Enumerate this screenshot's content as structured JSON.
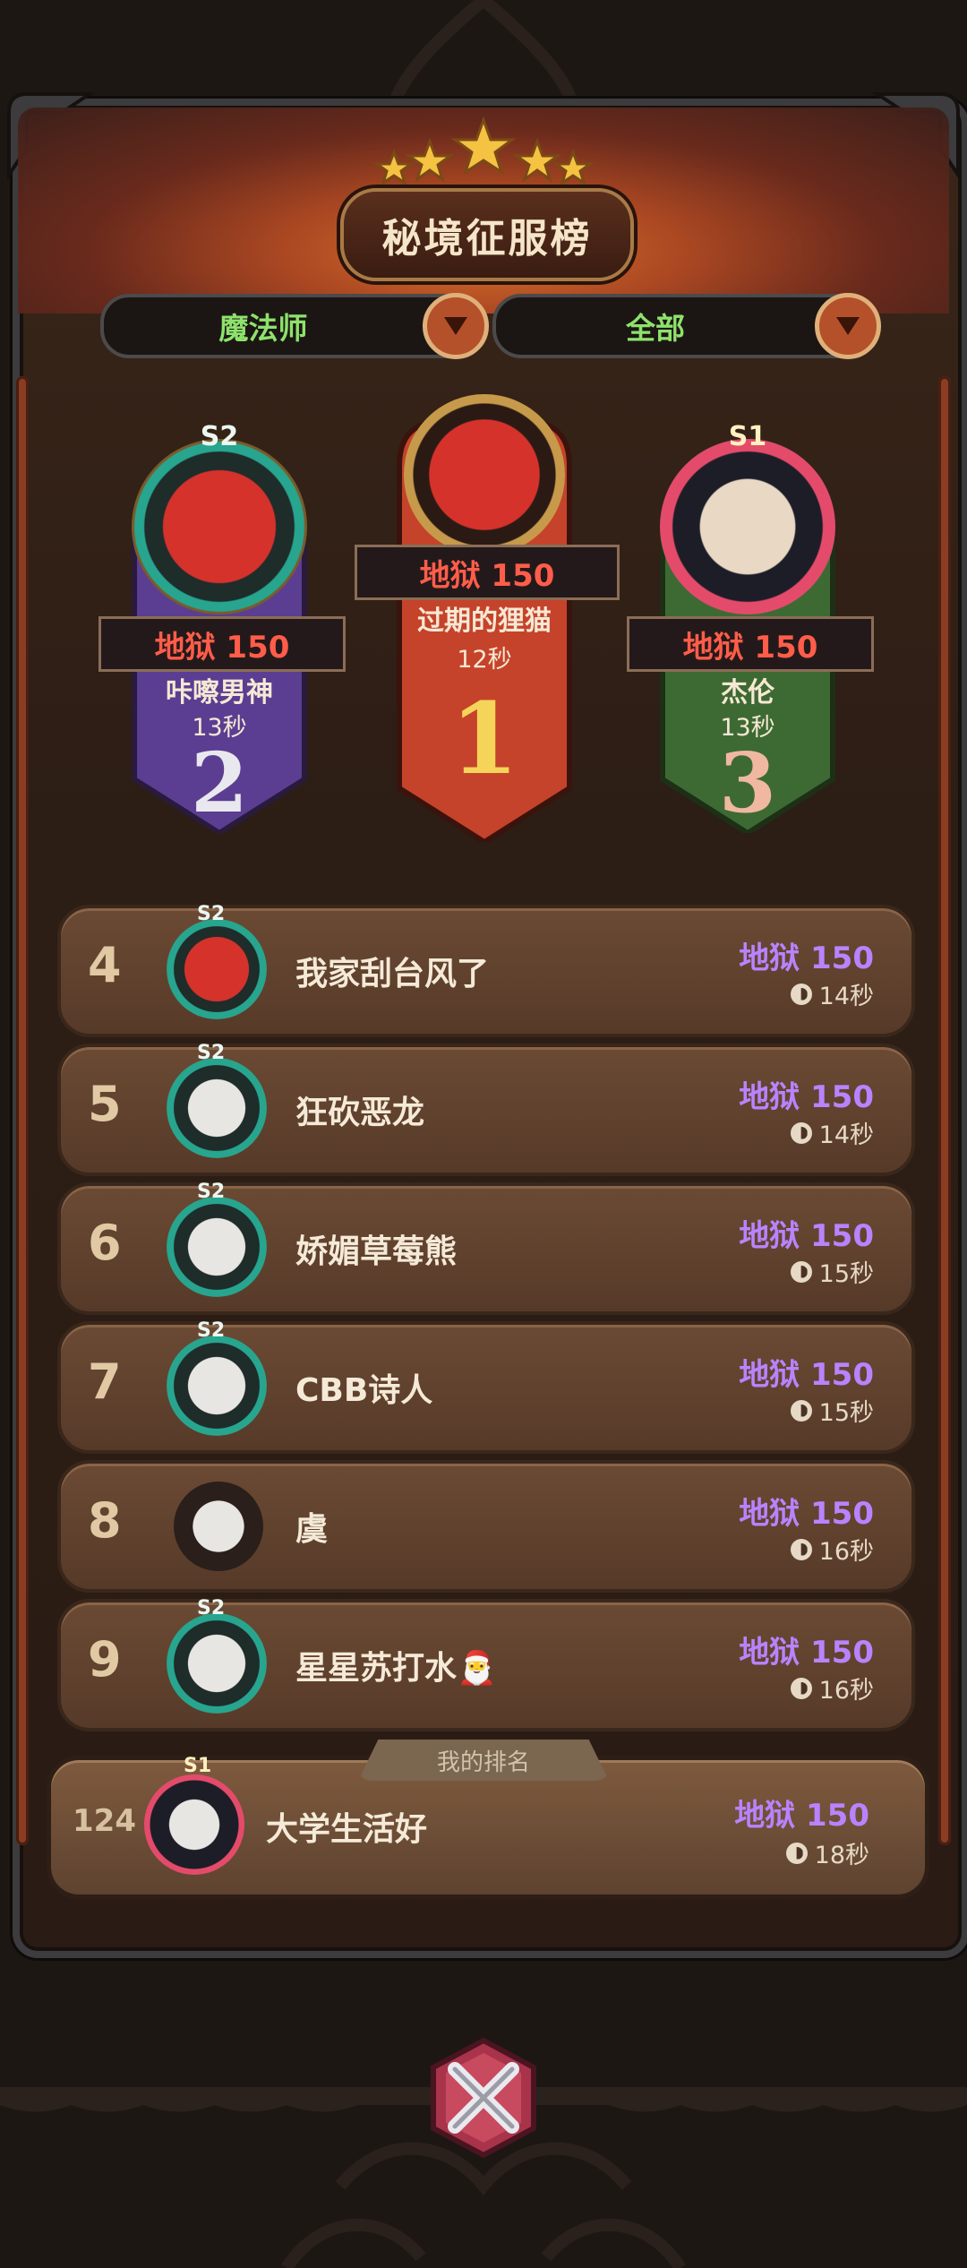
{
  "header": {
    "title": "秘境征服榜"
  },
  "filters": {
    "class_label": "魔法师",
    "scope_label": "全部"
  },
  "podium": [
    {
      "rank": "1",
      "difficulty": "地狱 150",
      "name": "过期的狸猫",
      "time": "12秒",
      "season": ""
    },
    {
      "rank": "2",
      "difficulty": "地狱 150",
      "name": "咔嚓男神",
      "time": "13秒",
      "season": "S2"
    },
    {
      "rank": "3",
      "difficulty": "地狱 150",
      "name": "杰伦",
      "time": "13秒",
      "season": "S1"
    }
  ],
  "list": [
    {
      "rank": "4",
      "name": "我家刮台风了",
      "difficulty": "地狱 150",
      "time": "14秒",
      "season": "S2"
    },
    {
      "rank": "5",
      "name": "狂砍恶龙",
      "difficulty": "地狱 150",
      "time": "14秒",
      "season": "S2"
    },
    {
      "rank": "6",
      "name": "娇媚草莓熊",
      "difficulty": "地狱 150",
      "time": "15秒",
      "season": "S2"
    },
    {
      "rank": "7",
      "name": "CBB诗人",
      "difficulty": "地狱 150",
      "time": "15秒",
      "season": "S2"
    },
    {
      "rank": "8",
      "name": "虞",
      "difficulty": "地狱 150",
      "time": "16秒",
      "season": ""
    },
    {
      "rank": "9",
      "name": "星星苏打水🎅",
      "difficulty": "地狱 150",
      "time": "16秒",
      "season": "S2"
    }
  ],
  "my_rank": {
    "tab_label": "我的排名",
    "rank": "124",
    "name": "大学生活好",
    "difficulty": "地狱 150",
    "time": "18秒",
    "season": "S1"
  },
  "colors": {
    "difficulty_red": "#ff5d4a",
    "difficulty_purple": "#b983ff",
    "filter_green": "#8ee26c"
  },
  "icons": {
    "close": "close-x-icon",
    "dropdown": "dropdown-triangle-icon",
    "clock": "clock-icon",
    "star": "star-icon"
  }
}
